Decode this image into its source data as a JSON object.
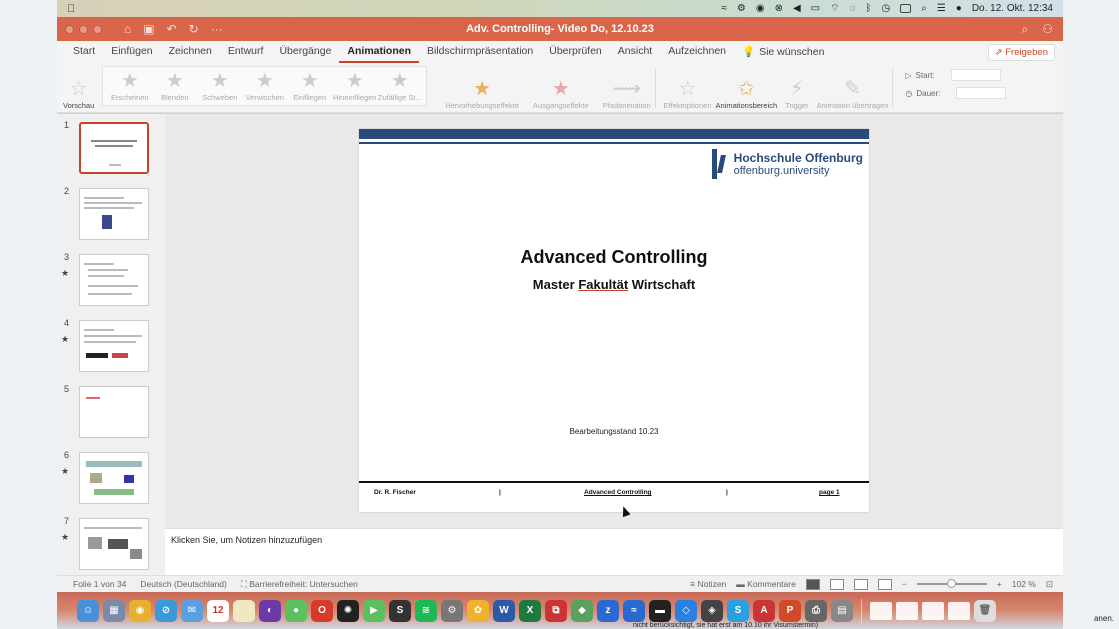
{
  "menubar": {
    "apple": "",
    "clock": "Do. 12. Okt.  12:34"
  },
  "window": {
    "title": "Adv. Controlling- Video Do, 12.10.23"
  },
  "tabs": [
    "Start",
    "Einfügen",
    "Zeichnen",
    "Entwurf",
    "Übergänge",
    "Animationen",
    "Bildschirmpräsentation",
    "Überprüfen",
    "Ansicht",
    "Aufzeichnen"
  ],
  "active_tab": "Animationen",
  "help_label": "Sie wünschen",
  "share_label": "Freigeben",
  "ribbon": {
    "preview_label": "Vorschau",
    "animations": [
      "Erscheinen",
      "Blenden",
      "Schweben",
      "Verwischen",
      "Einfliegen",
      "Hineinfliegen",
      "Zufällige St..."
    ],
    "effects_label": "Hervorhebungseffekte",
    "exit_label": "Ausgangseffekte",
    "path_label": "Pfadanimation",
    "options_label": "Effektoptionen",
    "pane_label": "Animationsbereich",
    "trigger_label": "Trigger",
    "painter_label": "Animation übertragen",
    "start_label": "Start:",
    "duration_label": "Dauer:"
  },
  "thumbnails": [
    {
      "num": "1",
      "star": ""
    },
    {
      "num": "2",
      "star": ""
    },
    {
      "num": "3",
      "star": "★"
    },
    {
      "num": "4",
      "star": "★"
    },
    {
      "num": "5",
      "star": ""
    },
    {
      "num": "6",
      "star": "★"
    },
    {
      "num": "7",
      "star": "★"
    }
  ],
  "slide": {
    "logo_name": "Hochschule Offenburg",
    "logo_url": "offenburg.university",
    "title": "Advanced Controlling",
    "subtitle_prefix": "Master ",
    "subtitle_underlined": "Fakultät",
    "subtitle_suffix": " Wirtschaft",
    "date_label": "Bearbeitungsstand 10.23",
    "footer_author": "Dr. R. Fischer",
    "footer_sep": "|",
    "footer_title": "Advanced Controlling",
    "footer_page": "page 1"
  },
  "notes_placeholder": "Klicken Sie, um Notizen hinzuzufügen",
  "status": {
    "slide_info": "Folie 1 von 34",
    "language": "Deutsch (Deutschland)",
    "accessibility": "Barrierefreiheit: Untersuchen",
    "notes": "Notizen",
    "comments": "Kommentare",
    "zoom": "102 %"
  },
  "edge_text": "anen.",
  "bottom_text": "nicht berücksichtigt, sie hat erst am 10.10 ihr Visumstermin)"
}
